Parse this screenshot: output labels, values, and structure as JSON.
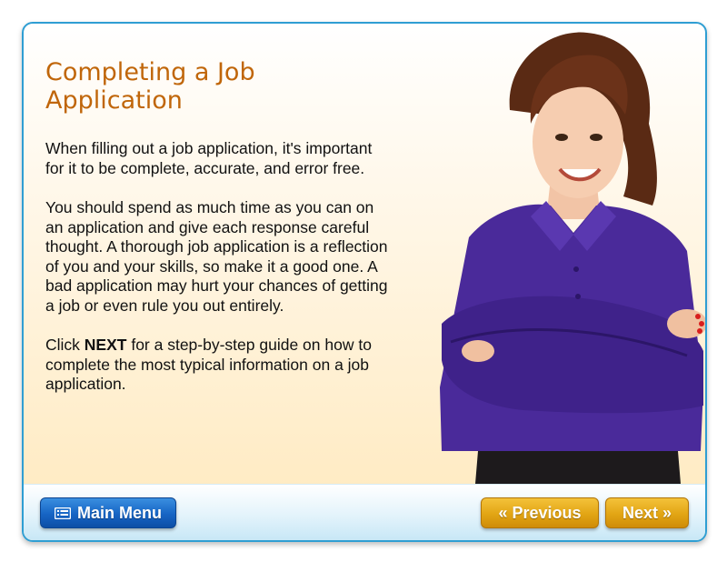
{
  "lesson": {
    "title": "Completing a Job Application",
    "paragraph1": "When filling out a job application, it's important for it to be complete, accurate, and error free.",
    "paragraph2": "You should spend as much time as you can on an application and give each response careful thought. A thorough job application is a reflection of you and your skills, so make it a good one. A bad application may hurt your chances of getting a job or even rule you out entirely.",
    "paragraph3_prefix": "Click ",
    "paragraph3_bold": "NEXT",
    "paragraph3_suffix": " for a step-by-step guide on how to complete the most typical information on a job application."
  },
  "nav": {
    "main_menu_label": "Main Menu",
    "previous_label": "Previous",
    "next_label": "Next",
    "previous_icon": "«",
    "next_icon": "»",
    "main_menu_icon": "menu-icon"
  },
  "colors": {
    "title": "#c0660a",
    "border": "#2f9ed3",
    "blue_button": "#1664c4",
    "gold_button": "#e2a514",
    "shirt": "#4a2a9a"
  }
}
